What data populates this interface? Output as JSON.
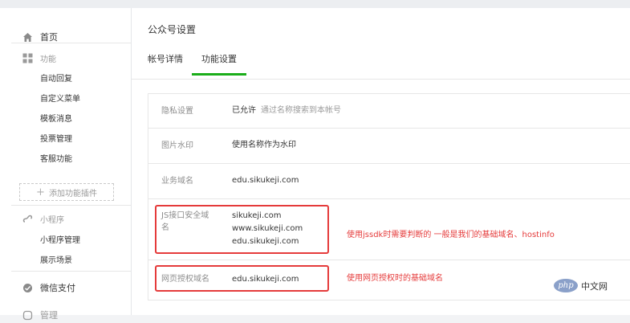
{
  "sidebar": {
    "home_label": "首页",
    "function_group": {
      "title": "功能",
      "items": [
        "自动回复",
        "自定义菜单",
        "模板消息",
        "投票管理",
        "客服功能"
      ],
      "add_plugin_label": "添加功能插件"
    },
    "miniprogram_group": {
      "title": "小程序",
      "items": [
        "小程序管理",
        "展示场景"
      ]
    },
    "pay_label": "微信支付",
    "next_label": "管理"
  },
  "main": {
    "page_title": "公众号设置",
    "tabs": [
      {
        "label": "帐号详情",
        "active": false
      },
      {
        "label": "功能设置",
        "active": true
      }
    ],
    "rows": [
      {
        "label": "隐私设置",
        "value": "已允许",
        "note": "通过名称搜索到本帐号"
      },
      {
        "label": "图片水印",
        "value": "使用名称作为水印"
      },
      {
        "label": "业务域名",
        "value": "edu.sikukeji.com"
      },
      {
        "label_line1": "JS接口安全域",
        "label_line2": "名",
        "values": [
          "sikukeji.com",
          "www.sikukeji.com",
          "edu.sikukeji.com"
        ]
      },
      {
        "label": "网页授权域名",
        "value": "edu.sikukeji.com"
      }
    ]
  },
  "annotations": {
    "js_domain": "使用jssdk时需要判断的  一般是我们的基础域名、hostinfo",
    "oauth_domain": "使用网页授权时的基础域名"
  },
  "watermark": {
    "logo_text": "php",
    "text": "中文网"
  },
  "colors": {
    "accent_green": "#1aad19",
    "annotation_red": "#e53b3b"
  }
}
